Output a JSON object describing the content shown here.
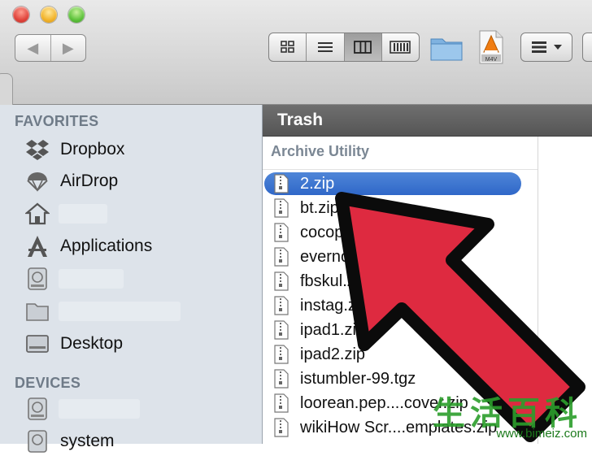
{
  "window": {
    "title": "Trash"
  },
  "toolbar": {
    "back": "◀",
    "forward": "▶",
    "icon_file_label": "M4V"
  },
  "sidebar": {
    "favorites_header": "FAVORITES",
    "favorites": [
      {
        "label": "Dropbox",
        "icon": "dropbox-icon"
      },
      {
        "label": "AirDrop",
        "icon": "airdrop-icon"
      },
      {
        "label": "",
        "icon": "home-icon"
      },
      {
        "label": "Applications",
        "icon": "applications-icon"
      },
      {
        "label": "",
        "icon": "disk-icon"
      },
      {
        "label": "",
        "icon": "folder-icon"
      },
      {
        "label": "Desktop",
        "icon": "desktop-icon"
      }
    ],
    "devices_header": "DEVICES",
    "devices": [
      {
        "label": "",
        "icon": "disk-icon"
      },
      {
        "label": "system",
        "icon": "disk-icon"
      }
    ]
  },
  "main": {
    "column_header": "Archive Utility",
    "files": [
      "2.zip",
      "bt.zip",
      "cocoppa.zip",
      "evernote.zip",
      "fbskul.zip",
      "instag.zip",
      "ipad1.zip",
      "ipad2.zip",
      "istumbler-99.tgz",
      "loorean.pep....cover.zip",
      "wikiHow Scr....emplates.zip"
    ],
    "selected_index": 0
  },
  "watermark": {
    "chars": "生活百科",
    "url": "www.bimeiz.com"
  },
  "colors": {
    "selection": "#3a72d2",
    "arrow_fill": "#de2a40",
    "sidebar_bg": "#dde3ea",
    "path_bar": "#5e5e5e"
  }
}
